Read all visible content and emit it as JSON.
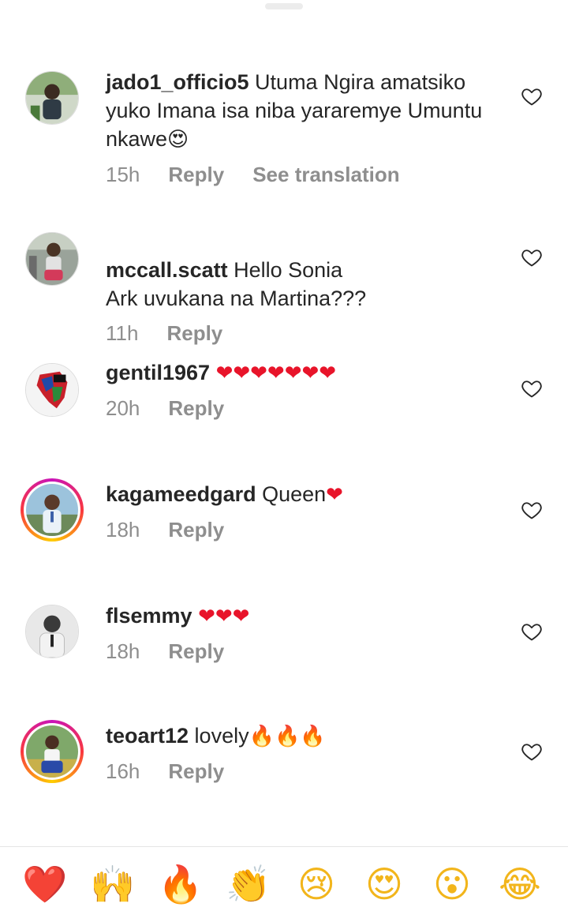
{
  "comments": [
    {
      "username": "jado1_officio5",
      "text": " Utuma Ngira amatsiko yuko Imana isa niba yararemye Umuntu nkawe",
      "emoji": "😍",
      "time": "15h",
      "reply": "Reply",
      "translate": "See translation"
    },
    {
      "username": "mccall.scatt",
      "text": " Hello Sonia\nArk uvukana na Martina???",
      "time": "11h",
      "reply": "Reply"
    },
    {
      "username": "gentil1967",
      "text": " ",
      "emoji": "❤❤❤❤❤❤❤",
      "time": "20h",
      "reply": "Reply"
    },
    {
      "username": "kagameedgard",
      "text": " Queen",
      "emoji": "❤",
      "time": "18h",
      "reply": "Reply"
    },
    {
      "username": "flsemmy",
      "text": " ",
      "emoji": "❤❤❤",
      "time": "18h",
      "reply": "Reply"
    },
    {
      "username": "teoart12",
      "text": " lovely",
      "emoji": "🔥🔥🔥",
      "time": "16h",
      "reply": "Reply"
    }
  ],
  "reactions": [
    "❤️",
    "🙌",
    "🔥",
    "👏",
    "😢",
    "😍",
    "😮",
    "😂"
  ],
  "colors": {
    "text": "#262626",
    "secondary": "#8e8e8e",
    "heart": "#e8142a",
    "story_ring_start": "#c913b9",
    "story_ring_end": "#fecd00"
  }
}
